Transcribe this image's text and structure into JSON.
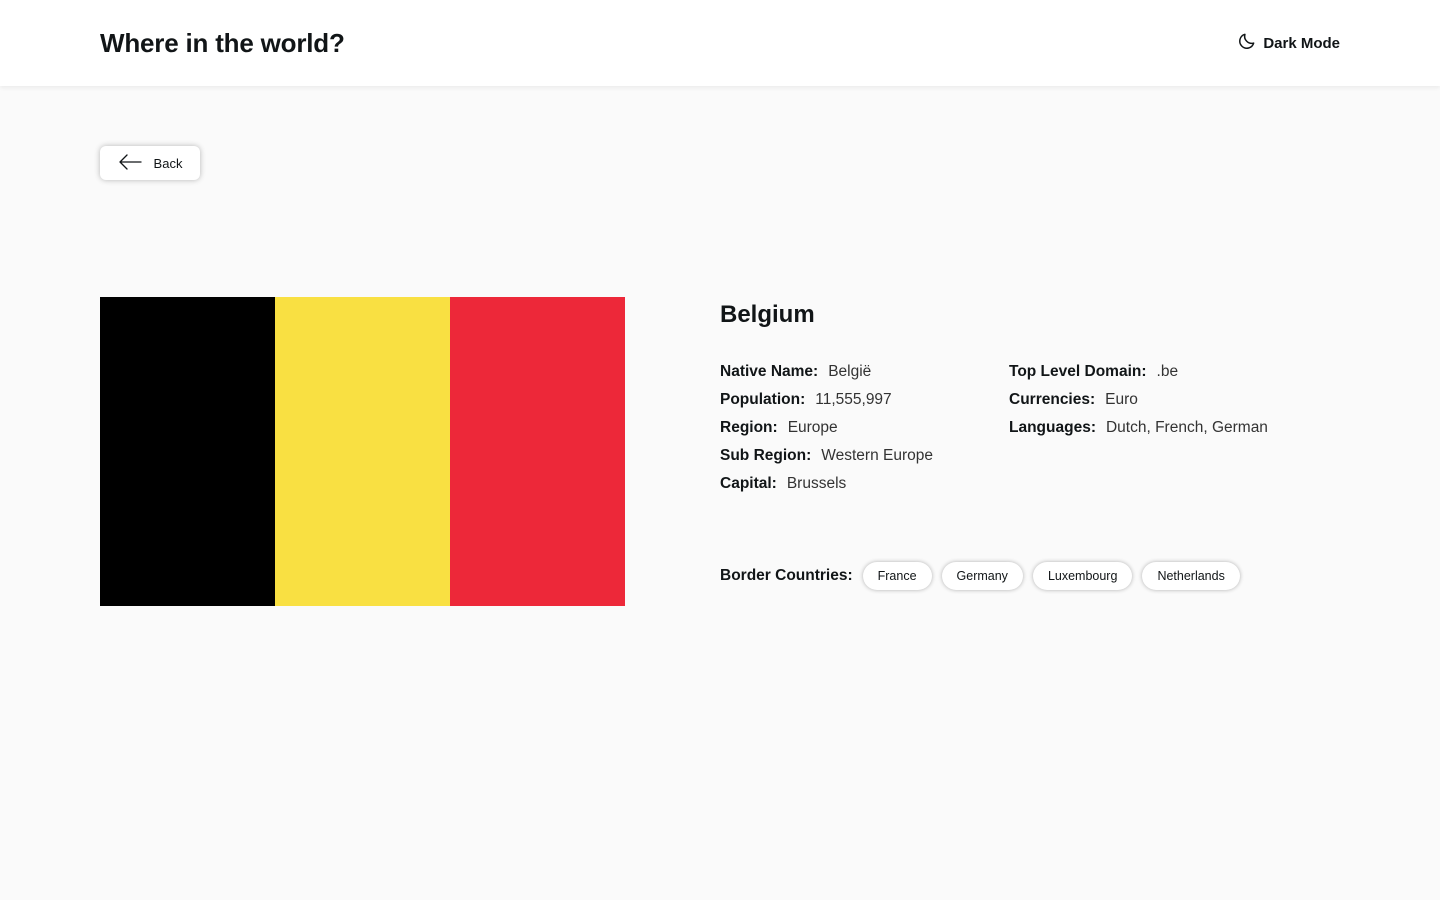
{
  "header": {
    "title": "Where in the world?",
    "theme_toggle": {
      "label": "Dark Mode",
      "icon": "moon-icon"
    }
  },
  "back": {
    "label": "Back",
    "icon": "arrow-left-icon"
  },
  "flag": {
    "colors": [
      "#000000",
      "#f9e042",
      "#ed2839"
    ]
  },
  "country": {
    "name": "Belgium",
    "left_info": [
      {
        "label": "Native Name:",
        "value": "België"
      },
      {
        "label": "Population:",
        "value": "11,555,997"
      },
      {
        "label": "Region:",
        "value": "Europe"
      },
      {
        "label": "Sub Region:",
        "value": "Western Europe"
      },
      {
        "label": "Capital:",
        "value": "Brussels"
      }
    ],
    "right_info": [
      {
        "label": "Top Level Domain:",
        "value": ".be"
      },
      {
        "label": "Currencies:",
        "value": "Euro"
      },
      {
        "label": "Languages:",
        "value": "Dutch, French, German"
      }
    ],
    "borders_label": "Border Countries:",
    "borders": [
      "France",
      "Germany",
      "Luxembourg",
      "Netherlands"
    ]
  }
}
